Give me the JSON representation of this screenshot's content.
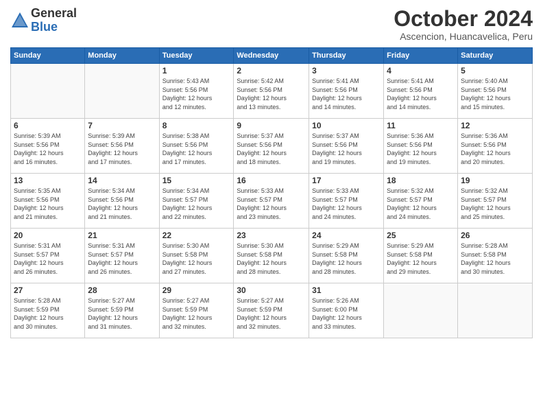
{
  "logo": {
    "general": "General",
    "blue": "Blue"
  },
  "header": {
    "title": "October 2024",
    "subtitle": "Ascencion, Huancavelica, Peru"
  },
  "weekdays": [
    "Sunday",
    "Monday",
    "Tuesday",
    "Wednesday",
    "Thursday",
    "Friday",
    "Saturday"
  ],
  "weeks": [
    [
      {
        "day": "",
        "info": ""
      },
      {
        "day": "",
        "info": ""
      },
      {
        "day": "1",
        "info": "Sunrise: 5:43 AM\nSunset: 5:56 PM\nDaylight: 12 hours\nand 12 minutes."
      },
      {
        "day": "2",
        "info": "Sunrise: 5:42 AM\nSunset: 5:56 PM\nDaylight: 12 hours\nand 13 minutes."
      },
      {
        "day": "3",
        "info": "Sunrise: 5:41 AM\nSunset: 5:56 PM\nDaylight: 12 hours\nand 14 minutes."
      },
      {
        "day": "4",
        "info": "Sunrise: 5:41 AM\nSunset: 5:56 PM\nDaylight: 12 hours\nand 14 minutes."
      },
      {
        "day": "5",
        "info": "Sunrise: 5:40 AM\nSunset: 5:56 PM\nDaylight: 12 hours\nand 15 minutes."
      }
    ],
    [
      {
        "day": "6",
        "info": "Sunrise: 5:39 AM\nSunset: 5:56 PM\nDaylight: 12 hours\nand 16 minutes."
      },
      {
        "day": "7",
        "info": "Sunrise: 5:39 AM\nSunset: 5:56 PM\nDaylight: 12 hours\nand 17 minutes."
      },
      {
        "day": "8",
        "info": "Sunrise: 5:38 AM\nSunset: 5:56 PM\nDaylight: 12 hours\nand 17 minutes."
      },
      {
        "day": "9",
        "info": "Sunrise: 5:37 AM\nSunset: 5:56 PM\nDaylight: 12 hours\nand 18 minutes."
      },
      {
        "day": "10",
        "info": "Sunrise: 5:37 AM\nSunset: 5:56 PM\nDaylight: 12 hours\nand 19 minutes."
      },
      {
        "day": "11",
        "info": "Sunrise: 5:36 AM\nSunset: 5:56 PM\nDaylight: 12 hours\nand 19 minutes."
      },
      {
        "day": "12",
        "info": "Sunrise: 5:36 AM\nSunset: 5:56 PM\nDaylight: 12 hours\nand 20 minutes."
      }
    ],
    [
      {
        "day": "13",
        "info": "Sunrise: 5:35 AM\nSunset: 5:56 PM\nDaylight: 12 hours\nand 21 minutes."
      },
      {
        "day": "14",
        "info": "Sunrise: 5:34 AM\nSunset: 5:56 PM\nDaylight: 12 hours\nand 21 minutes."
      },
      {
        "day": "15",
        "info": "Sunrise: 5:34 AM\nSunset: 5:57 PM\nDaylight: 12 hours\nand 22 minutes."
      },
      {
        "day": "16",
        "info": "Sunrise: 5:33 AM\nSunset: 5:57 PM\nDaylight: 12 hours\nand 23 minutes."
      },
      {
        "day": "17",
        "info": "Sunrise: 5:33 AM\nSunset: 5:57 PM\nDaylight: 12 hours\nand 24 minutes."
      },
      {
        "day": "18",
        "info": "Sunrise: 5:32 AM\nSunset: 5:57 PM\nDaylight: 12 hours\nand 24 minutes."
      },
      {
        "day": "19",
        "info": "Sunrise: 5:32 AM\nSunset: 5:57 PM\nDaylight: 12 hours\nand 25 minutes."
      }
    ],
    [
      {
        "day": "20",
        "info": "Sunrise: 5:31 AM\nSunset: 5:57 PM\nDaylight: 12 hours\nand 26 minutes."
      },
      {
        "day": "21",
        "info": "Sunrise: 5:31 AM\nSunset: 5:57 PM\nDaylight: 12 hours\nand 26 minutes."
      },
      {
        "day": "22",
        "info": "Sunrise: 5:30 AM\nSunset: 5:58 PM\nDaylight: 12 hours\nand 27 minutes."
      },
      {
        "day": "23",
        "info": "Sunrise: 5:30 AM\nSunset: 5:58 PM\nDaylight: 12 hours\nand 28 minutes."
      },
      {
        "day": "24",
        "info": "Sunrise: 5:29 AM\nSunset: 5:58 PM\nDaylight: 12 hours\nand 28 minutes."
      },
      {
        "day": "25",
        "info": "Sunrise: 5:29 AM\nSunset: 5:58 PM\nDaylight: 12 hours\nand 29 minutes."
      },
      {
        "day": "26",
        "info": "Sunrise: 5:28 AM\nSunset: 5:58 PM\nDaylight: 12 hours\nand 30 minutes."
      }
    ],
    [
      {
        "day": "27",
        "info": "Sunrise: 5:28 AM\nSunset: 5:59 PM\nDaylight: 12 hours\nand 30 minutes."
      },
      {
        "day": "28",
        "info": "Sunrise: 5:27 AM\nSunset: 5:59 PM\nDaylight: 12 hours\nand 31 minutes."
      },
      {
        "day": "29",
        "info": "Sunrise: 5:27 AM\nSunset: 5:59 PM\nDaylight: 12 hours\nand 32 minutes."
      },
      {
        "day": "30",
        "info": "Sunrise: 5:27 AM\nSunset: 5:59 PM\nDaylight: 12 hours\nand 32 minutes."
      },
      {
        "day": "31",
        "info": "Sunrise: 5:26 AM\nSunset: 6:00 PM\nDaylight: 12 hours\nand 33 minutes."
      },
      {
        "day": "",
        "info": ""
      },
      {
        "day": "",
        "info": ""
      }
    ]
  ]
}
